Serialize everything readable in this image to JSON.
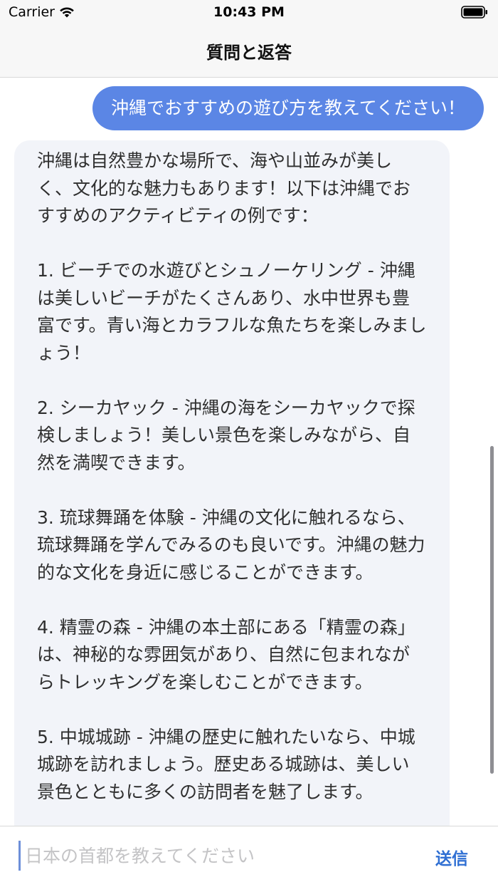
{
  "status_bar": {
    "carrier": "Carrier",
    "time": "10:43 PM",
    "wifi_icon": "wifi-icon",
    "battery_icon": "battery-icon"
  },
  "nav": {
    "title": "質問と返答"
  },
  "chat": {
    "user_message": "沖縄でおすすめの遊び方を教えてください！",
    "assistant_message": {
      "intro": "沖縄は自然豊かな場所で、海や山並みが美しく、文化的な魅力もあります！以下は沖縄でおすすめのアクティビティの例です：",
      "items": [
        "1. ビーチでの水遊びとシュノーケリング - 沖縄は美しいビーチがたくさんあり、水中世界も豊富です。青い海とカラフルな魚たちを楽しみましょう！",
        "2. シーカヤック - 沖縄の海をシーカヤックで探検しましょう！美しい景色を楽しみながら、自然を満喫できます。",
        "3. 琉球舞踊を体験 - 沖縄の文化に触れるなら、琉球舞踊を学んでみるのも良いです。沖縄の魅力的な文化を身近に感じることができます。",
        "4. 精霊の森 - 沖縄の本土部にある「精霊の森」は、神秘的な雰囲気があり、自然に包まれながらトレッキングを楽しむことができます。",
        "5. 中城城跡 - 沖縄の歴史に触れたいなら、中城城跡を訪れましょう。歴史ある城跡は、美しい景色とともに多くの訪問者を魅了します。"
      ]
    }
  },
  "input": {
    "placeholder": "日本の首都を教えてください",
    "value": "",
    "send_label": "送信"
  },
  "colors": {
    "user_bubble": "#5b86e5",
    "assistant_bubble": "#f2f4f9",
    "send_button": "#2f6fd3",
    "bar_background": "#f7f7f7"
  }
}
